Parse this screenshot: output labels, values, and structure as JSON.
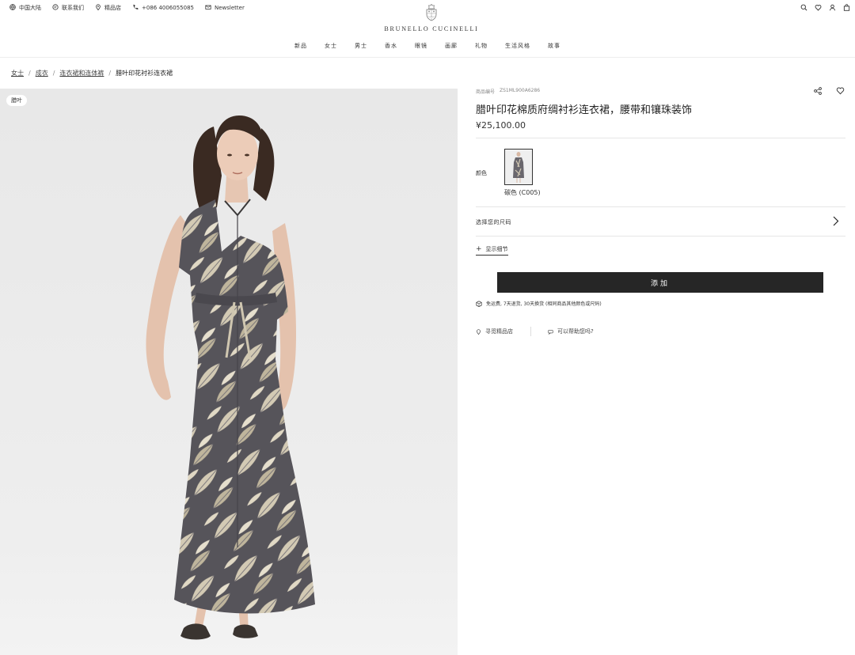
{
  "utility": {
    "region": "中国大陆",
    "contact": "联系我们",
    "stores": "精品店",
    "phone": "+086 4006055085",
    "newsletter": "Newsletter"
  },
  "brand": {
    "name": "BRUNELLO CUCINELLI"
  },
  "nav": [
    "新品",
    "女士",
    "男士",
    "香水",
    "眼镜",
    "画廊",
    "礼物",
    "生活风格",
    "故事"
  ],
  "breadcrumb": {
    "items": [
      "女士",
      "成衣",
      "连衣裙和连体裤"
    ],
    "current": "腊叶印花衬衫连衣裙"
  },
  "image": {
    "tag": "腊叶"
  },
  "product": {
    "sku_label": "商品编号",
    "sku": "ZS1ML900A6286",
    "title": "腊叶印花棉质府绸衬衫连衣裙，腰带和镶珠装饰",
    "price": "¥25,100.00",
    "color_label": "颜色",
    "color_name": "碳色 (C005)",
    "size_label": "选择您的尺码",
    "details_label": "显示细节",
    "add_label": "添加",
    "shipping_note": "免运费, 7天退货, 30天换货 (相同商品其他颜色或尺码)",
    "find_store": "寻觅精品店",
    "help": "可以帮助您吗?"
  },
  "colors": {
    "accent": "#262626",
    "photo_bg": "#ebebeb",
    "dress_dark": "#56545a",
    "dress_light": "#cfc6b0"
  },
  "icons": [
    "globe-icon",
    "contact-icon",
    "pin-icon",
    "phone-icon",
    "mail-icon",
    "search-icon",
    "heart-icon",
    "user-icon",
    "bag-icon",
    "share-icon",
    "truck-icon",
    "chevron-right-icon",
    "plus-icon",
    "chat-icon"
  ]
}
